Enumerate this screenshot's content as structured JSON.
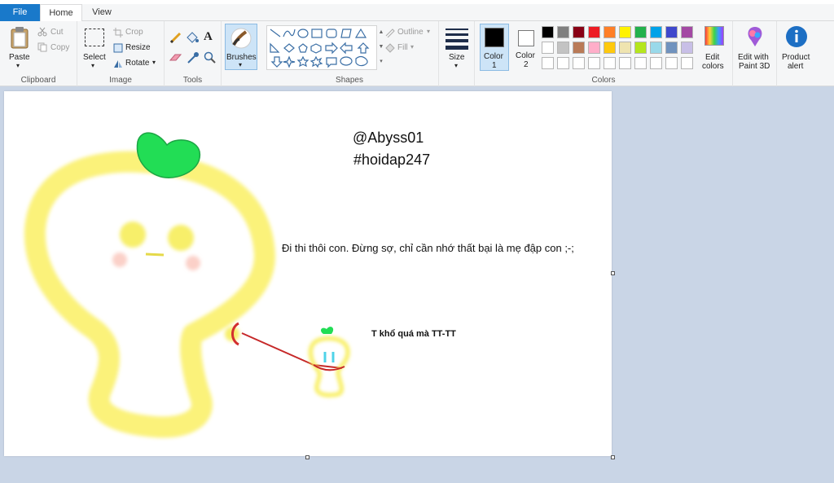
{
  "tabs": {
    "file": "File",
    "home": "Home",
    "view": "View"
  },
  "clipboard": {
    "paste": "Paste",
    "cut": "Cut",
    "copy": "Copy",
    "group": "Clipboard"
  },
  "image": {
    "select": "Select",
    "crop": "Crop",
    "resize": "Resize",
    "rotate": "Rotate",
    "group": "Image"
  },
  "tools": {
    "group": "Tools"
  },
  "brushes": {
    "label": "Brushes"
  },
  "shapes": {
    "outline": "Outline",
    "fill": "Fill",
    "group": "Shapes"
  },
  "size": {
    "label": "Size"
  },
  "colors": {
    "color1_line1": "Color",
    "color1_line2": "1",
    "color2_line1": "Color",
    "color2_line2": "2",
    "edit_line1": "Edit",
    "edit_line2": "colors",
    "group": "Colors",
    "row1": [
      "#000000",
      "#7f7f7f",
      "#880015",
      "#ed1c24",
      "#ff7f27",
      "#fff200",
      "#22b14c",
      "#00a2e8",
      "#3f48cc",
      "#a349a4"
    ],
    "row2": [
      "#ffffff",
      "#c3c3c3",
      "#b97a57",
      "#ffaec9",
      "#ffc90e",
      "#efe4b0",
      "#b5e61d",
      "#99d9ea",
      "#7092be",
      "#c8bfe7"
    ],
    "row3": [
      "#ffffff",
      "#ffffff",
      "#ffffff",
      "#ffffff",
      "#ffffff",
      "#ffffff",
      "#ffffff",
      "#ffffff",
      "#ffffff",
      "#ffffff"
    ]
  },
  "paint3d": {
    "line1": "Edit with",
    "line2": "Paint 3D"
  },
  "alert": {
    "line1": "Product",
    "line2": "alert"
  },
  "drawing": {
    "handle": "@Abyss01",
    "hashtag": "#hoidap247",
    "message": "Đi thi thôi con. Đừng sợ, chỉ cần nhớ thất bại là mẹ đập con ;-;",
    "reply": "T khổ quá mà TT-TT"
  }
}
